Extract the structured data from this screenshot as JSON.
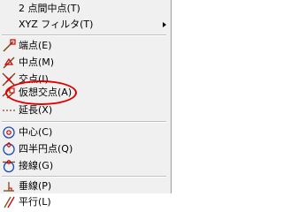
{
  "menu": {
    "items": [
      {
        "label": "2 点間中点(T)",
        "icon": "",
        "submenu": false
      },
      {
        "label": "XYZ フィルタ(T)",
        "icon": "",
        "submenu": true
      },
      {
        "label": "端点(E)",
        "icon": "endpoint-icon",
        "submenu": false
      },
      {
        "label": "中点(M)",
        "icon": "midpoint-icon",
        "submenu": false
      },
      {
        "label": "交点(I)",
        "icon": "intersection-icon",
        "submenu": false
      },
      {
        "label": "仮想交点(A)",
        "icon": "apparent-intersection-icon",
        "submenu": false
      },
      {
        "label": "延長(X)",
        "icon": "extension-icon",
        "submenu": false
      },
      {
        "label": "中心(C)",
        "icon": "center-icon",
        "submenu": false
      },
      {
        "label": "四半円点(Q)",
        "icon": "quadrant-icon",
        "submenu": false
      },
      {
        "label": "接線(G)",
        "icon": "tangent-icon",
        "submenu": false
      },
      {
        "label": "垂線(P)",
        "icon": "perpendicular-icon",
        "submenu": false
      },
      {
        "label": "平行(L)",
        "icon": "parallel-icon",
        "submenu": false
      }
    ]
  },
  "annotation": {
    "color": "#e00000",
    "target": "仮想交点(A)"
  }
}
